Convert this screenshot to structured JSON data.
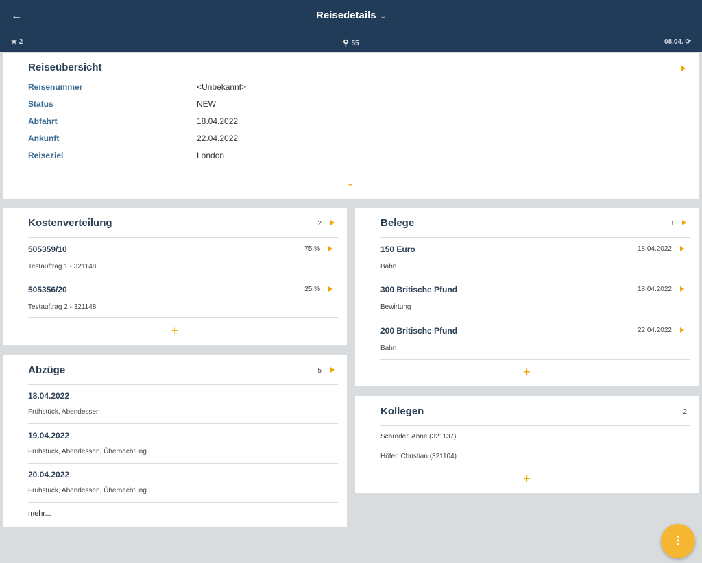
{
  "header": {
    "title": "Reisedetails",
    "back_icon": "←",
    "title_dropdown_icon": "⌄",
    "star_count": "★ 2",
    "center_value": "55",
    "date_text": "08.04.",
    "refresh_icon": "⟳"
  },
  "overview": {
    "title": "Reiseübersicht",
    "rows": [
      {
        "label": "Reisenummer",
        "value": "<Unbekannt>"
      },
      {
        "label": "Status",
        "value": "NEW"
      },
      {
        "label": "Abfahrt",
        "value": "18.04.2022"
      },
      {
        "label": "Ankunft",
        "value": "22.04.2022"
      },
      {
        "label": "Reiseziel",
        "value": "London"
      }
    ],
    "expand_icon": "⌄"
  },
  "kosten": {
    "title": "Kostenverteilung",
    "count": "2",
    "items": [
      {
        "title": "505359/10",
        "percent": "75 %",
        "sub": "Testauftrag 1 - 321148"
      },
      {
        "title": "505356/20",
        "percent": "25 %",
        "sub": "Testauftrag 2 - 321148"
      }
    ],
    "add": "+"
  },
  "belege": {
    "title": "Belege",
    "count": "3",
    "items": [
      {
        "title": "150 Euro",
        "date": "18.04.2022",
        "sub": "Bahn"
      },
      {
        "title": "300 Britische Pfund",
        "date": "18.04.2022",
        "sub": "Bewirtung"
      },
      {
        "title": "200 Britische Pfund",
        "date": "22.04.2022",
        "sub": "Bahn"
      }
    ],
    "add": "+"
  },
  "abzuege": {
    "title": "Abzüge",
    "count": "5",
    "items": [
      {
        "title": "18.04.2022",
        "sub": "Frühstück, Abendessen"
      },
      {
        "title": "19.04.2022",
        "sub": "Frühstück, Abendessen, Übernachtung"
      },
      {
        "title": "20.04.2022",
        "sub": "Frühstück, Abendessen, Übernachtung"
      }
    ],
    "more": "mehr..."
  },
  "kollegen": {
    "title": "Kollegen",
    "count": "2",
    "items": [
      {
        "name": "Schröder, Anne (321137)"
      },
      {
        "name": "Höfer, Christian (321104)"
      }
    ],
    "add": "+"
  },
  "fab": {
    "icon": "⋮"
  },
  "colors": {
    "header_bg": "#213c58",
    "accent": "#f0a500",
    "label_blue": "#3b6c96",
    "page_bg": "#d9dcdf"
  }
}
